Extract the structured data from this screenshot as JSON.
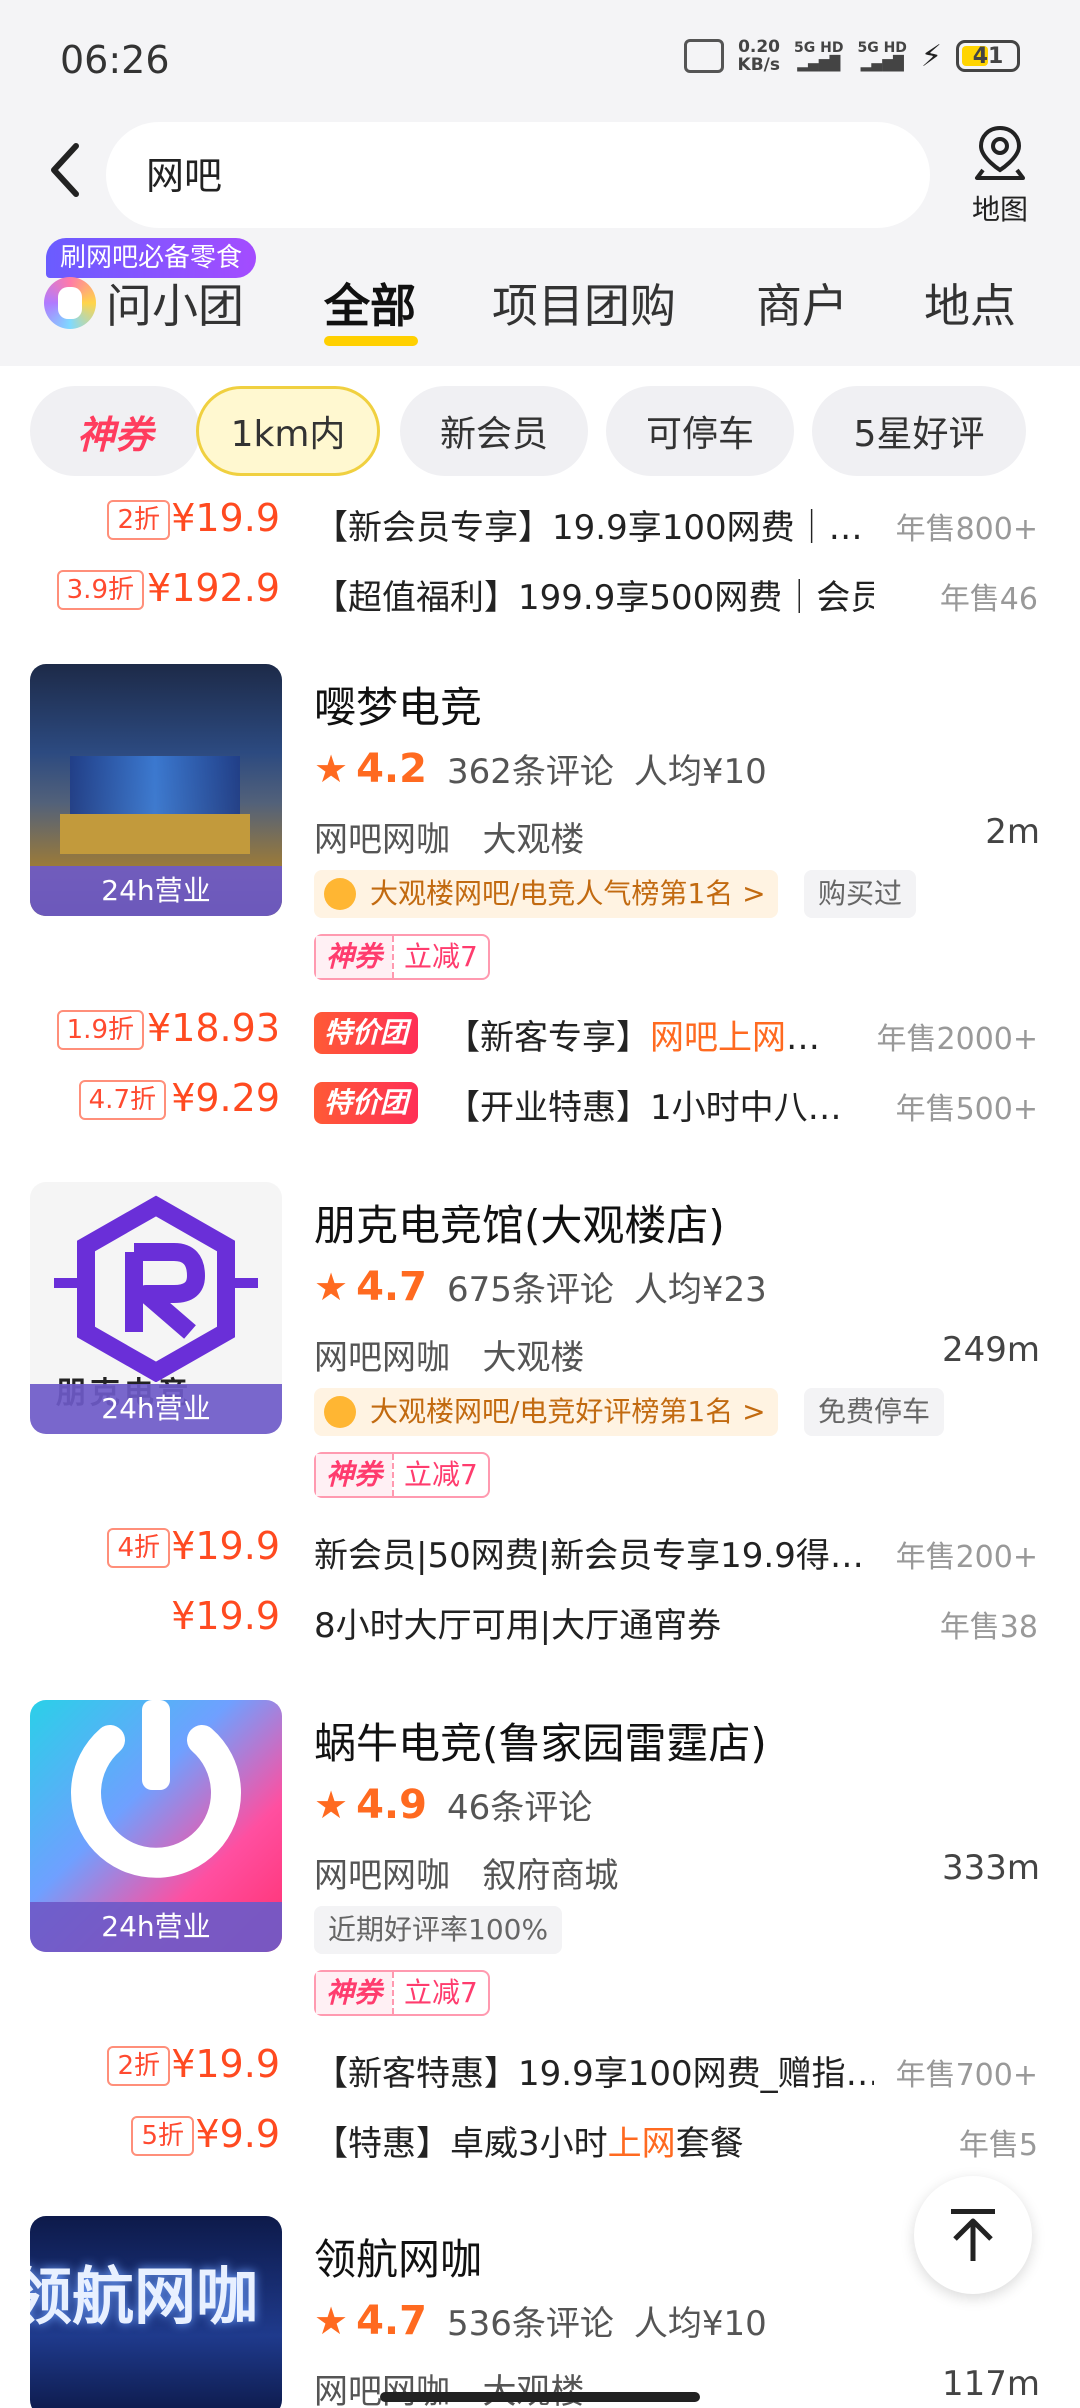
{
  "status_bar": {
    "time": "06:26",
    "net_speed": "0.20",
    "net_unit": "KB/s",
    "sim1": "5G HD",
    "sim2": "5G HD",
    "battery": "41"
  },
  "search": {
    "query": "网吧"
  },
  "map_button": {
    "label": "地图"
  },
  "promo_badge": "刷网吧必备零食",
  "tabs": [
    {
      "label": "问小团"
    },
    {
      "label": "全部"
    },
    {
      "label": "项目团购"
    },
    {
      "label": "商户"
    },
    {
      "label": "地点"
    }
  ],
  "filters": [
    "神券",
    "1km内",
    "新会员",
    "可停车",
    "5星好评"
  ],
  "top_deals": [
    {
      "discount": "2折",
      "price": "¥19.9",
      "title": "【新会员专享】19.9享100网费｜…",
      "sales": "年售800+"
    },
    {
      "discount": "3.9折",
      "price": "¥192.9",
      "title": "【超值福利】199.9享500网费｜会员…",
      "sales": "年售46"
    }
  ],
  "shops": [
    {
      "name": "嘤梦电竞",
      "score": "4.2",
      "reviews": "362条评论",
      "avg": "人均¥10",
      "category": "网吧网咖",
      "area": "大观楼",
      "distance": "2m",
      "hours": "24h营业",
      "rank": "大观楼网吧/电竞人气榜第1名 >",
      "side_tag": "购买过",
      "coupon_a": "神券",
      "coupon_b": "立减7",
      "deals": [
        {
          "discount": "1.9折",
          "price": "¥18.93",
          "badge": "特价团",
          "title_a": "【新客专享】",
          "title_hl": "网吧上网",
          "title_b": "…",
          "sales": "年售2000+"
        },
        {
          "discount": "4.7折",
          "price": "¥9.29",
          "badge": "特价团",
          "title_a": "【开业特惠】1小时中八…",
          "title_hl": "",
          "title_b": "",
          "sales": "年售500+"
        }
      ]
    },
    {
      "name": "朋克电竞馆(大观楼店)",
      "score": "4.7",
      "reviews": "675条评论",
      "avg": "人均¥23",
      "category": "网吧网咖",
      "area": "大观楼",
      "distance": "249m",
      "hours": "24h营业",
      "thumb_text": "朋克电竞",
      "rank": "大观楼网吧/电竞好评榜第1名 >",
      "side_tag": "免费停车",
      "coupon_a": "神券",
      "coupon_b": "立减7",
      "deals": [
        {
          "discount": "4折",
          "price": "¥19.9",
          "title": "新会员|50网费|新会员专享19.9得…",
          "sales": "年售200+"
        },
        {
          "discount": "",
          "price": "¥19.9",
          "title": "8小时大厅可用|大厅通宵券",
          "sales": "年售38"
        }
      ]
    },
    {
      "name": "蜗牛电竞(鲁家园雷霆店)",
      "score": "4.9",
      "reviews": "46条评论",
      "category": "网吧网咖",
      "area": "叙府商城",
      "distance": "333m",
      "hours": "24h营业",
      "good_rate": "近期好评率100%",
      "coupon_a": "神券",
      "coupon_b": "立减7",
      "deals": [
        {
          "discount": "2折",
          "price": "¥19.9",
          "title": "【新客特惠】19.9享100网费_赠指…",
          "sales": "年售700+"
        },
        {
          "discount": "5折",
          "price": "¥9.9",
          "title_a": "【特惠】卓威3小时",
          "title_hl": "上网",
          "title_b": "套餐",
          "sales": "年售5"
        }
      ]
    },
    {
      "name": "领航网咖",
      "score": "4.7",
      "reviews": "536条评论",
      "avg": "人均¥10",
      "category": "网吧网咖",
      "area": "大观楼",
      "distance": "117m",
      "thumb_text": "领航网咖"
    }
  ],
  "colors": {
    "accent": "#ffd000",
    "price": "#ff4a20",
    "coupon": "#ff3c5e"
  }
}
